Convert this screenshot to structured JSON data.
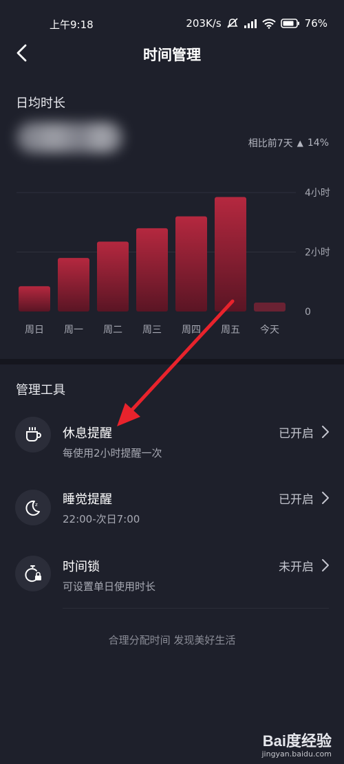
{
  "status_bar": {
    "time": "上午9:18",
    "speed": "203K/s",
    "battery": "76%"
  },
  "nav": {
    "title": "时间管理",
    "back_icon": "chevron-left-icon"
  },
  "daily_avg": {
    "title": "日均时长",
    "compare_label": "相比前7天",
    "compare_value": "14%",
    "compare_icon": "arrow-up-icon"
  },
  "chart_data": {
    "type": "bar",
    "categories": [
      "周日",
      "周一",
      "周二",
      "周三",
      "周四",
      "周五",
      "今天"
    ],
    "values": [
      0.85,
      1.8,
      2.35,
      2.8,
      3.2,
      3.85,
      0.3
    ],
    "ylim": [
      0,
      4
    ],
    "yticks": [
      {
        "value": 4,
        "label": "4小时"
      },
      {
        "value": 2,
        "label": "2小时"
      },
      {
        "value": 0,
        "label": "0"
      }
    ],
    "bar_color_top": "#b5283f",
    "bar_color_bottom": "#5a1524",
    "today_color": "#6a2233"
  },
  "tools": {
    "title": "管理工具",
    "items": [
      {
        "name": "休息提醒",
        "desc": "每使用2小时提醒一次",
        "status": "已开启",
        "icon": "coffee-cup-icon"
      },
      {
        "name": "睡觉提醒",
        "desc": "22:00-次日7:00",
        "status": "已开启",
        "icon": "moon-icon"
      },
      {
        "name": "时间锁",
        "desc": "可设置单日使用时长",
        "status": "未开启",
        "icon": "timer-lock-icon"
      }
    ]
  },
  "footer": {
    "text": "合理分配时间 发现美好生活"
  },
  "annotation": {
    "color": "#e8232c"
  },
  "watermark": {
    "logo": "Bai度经验",
    "url": "jingyan.baidu.com"
  }
}
